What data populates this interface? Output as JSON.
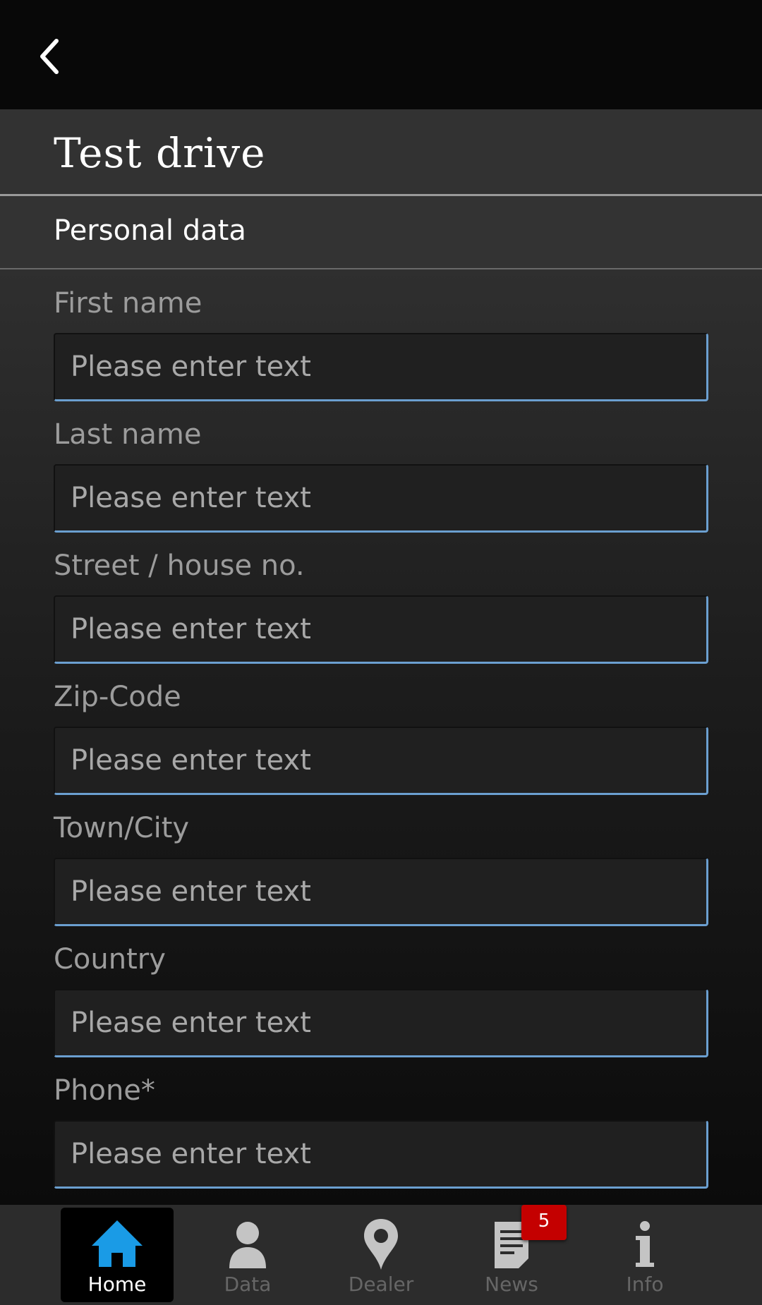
{
  "header": {
    "back_icon": "chevron-left-icon"
  },
  "page": {
    "title": "Test drive",
    "section_title": "Personal data"
  },
  "form": {
    "fields": [
      {
        "label": "First name",
        "placeholder": "Please enter text",
        "value": ""
      },
      {
        "label": "Last name",
        "placeholder": "Please enter text",
        "value": ""
      },
      {
        "label": "Street / house no.",
        "placeholder": "Please enter text",
        "value": ""
      },
      {
        "label": "Zip-Code",
        "placeholder": "Please enter text",
        "value": ""
      },
      {
        "label": "Town/City",
        "placeholder": "Please enter text",
        "value": ""
      },
      {
        "label": "Country",
        "placeholder": "Please enter text",
        "value": ""
      },
      {
        "label": "Phone*",
        "placeholder": "Please enter text",
        "value": ""
      }
    ]
  },
  "nav": {
    "items": [
      {
        "label": "Home",
        "icon": "home-icon",
        "active": true
      },
      {
        "label": "Data",
        "icon": "person-icon",
        "active": false
      },
      {
        "label": "Dealer",
        "icon": "location-pin-icon",
        "active": false
      },
      {
        "label": "News",
        "icon": "newspaper-icon",
        "active": false
      },
      {
        "label": "Info",
        "icon": "info-icon",
        "active": false
      }
    ],
    "news_badge": "5"
  },
  "colors": {
    "accent": "#1a9be6",
    "badge": "#c40000",
    "input_border": "#6b9fd0"
  }
}
